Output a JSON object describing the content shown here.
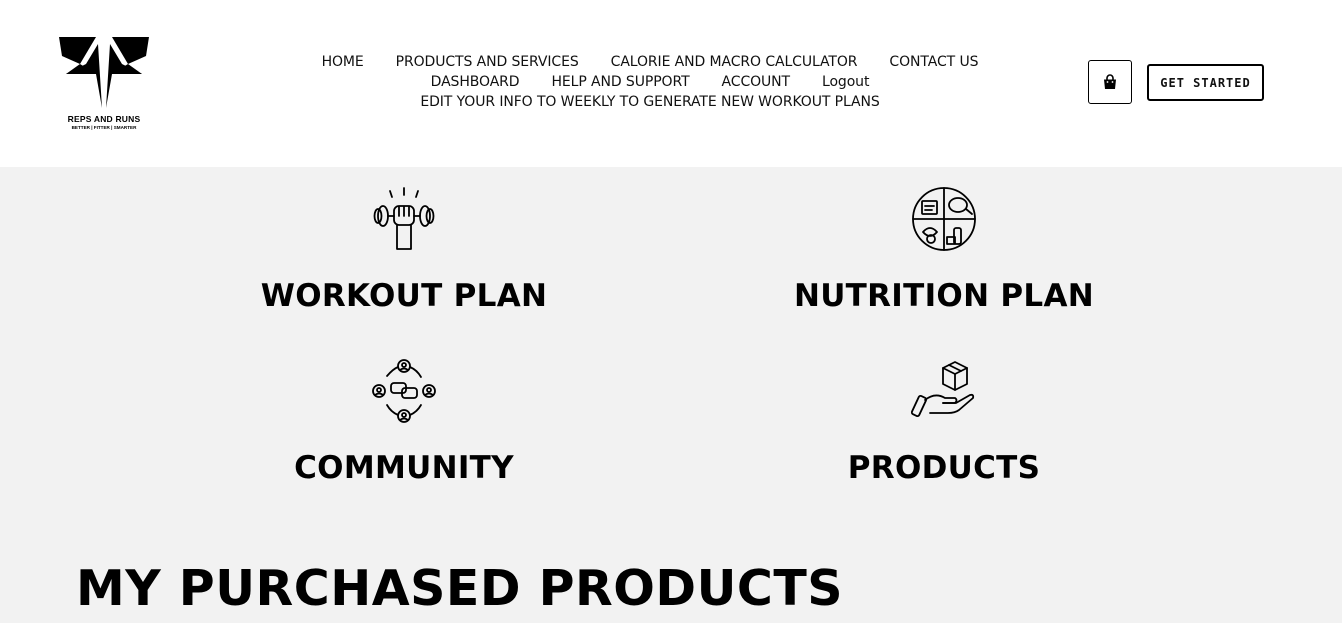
{
  "brand": {
    "name": "REPS AND RUNS",
    "tagline": "BETTER | FITTER | SMARTER"
  },
  "nav": {
    "row1": [
      "HOME",
      "PRODUCTS AND SERVICES",
      "CALORIE AND MACRO CALCULATOR",
      "CONTACT US"
    ],
    "row2": [
      "DASHBOARD",
      "HELP AND SUPPORT",
      "ACCOUNT",
      "Logout"
    ],
    "row3": [
      "EDIT YOUR INFO TO WEEKLY TO GENERATE NEW WORKOUT PLANS"
    ]
  },
  "header_actions": {
    "cart_icon": "shopping-bag-icon",
    "cta_label": "GET STARTED"
  },
  "features": [
    {
      "title": "WORKOUT PLAN",
      "icon": "dumbbell-fist-icon"
    },
    {
      "title": "NUTRITION PLAN",
      "icon": "food-plate-icon"
    },
    {
      "title": "COMMUNITY",
      "icon": "community-chat-icon"
    },
    {
      "title": "PRODUCTS",
      "icon": "hand-box-icon"
    }
  ],
  "main": {
    "section_title": "MY PURCHASED PRODUCTS"
  }
}
